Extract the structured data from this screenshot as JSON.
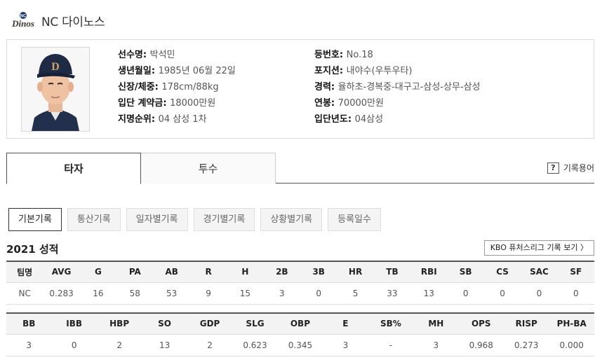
{
  "header": {
    "logo_text": "Dinos",
    "logo_badge": "NC",
    "team_name": "NC 다이노스"
  },
  "player": {
    "left": [
      {
        "key": "선수명: ",
        "value": "박석민"
      },
      {
        "key": "생년월일: ",
        "value": "1985년 06월 22일"
      },
      {
        "key": "신장/체중: ",
        "value": "178cm/88kg"
      },
      {
        "key": "입단 계약금: ",
        "value": "18000만원"
      },
      {
        "key": "지명순위: ",
        "value": "04 삼성 1차"
      }
    ],
    "right": [
      {
        "key": "등번호: ",
        "value": "No.18"
      },
      {
        "key": "포지션: ",
        "value": "내야수(우투우타)"
      },
      {
        "key": "경력: ",
        "value": "율하초-경복중-대구고-삼성-상무-삼성"
      },
      {
        "key": "연봉: ",
        "value": "70000만원"
      },
      {
        "key": "입단년도: ",
        "value": "04삼성"
      }
    ]
  },
  "tabs": {
    "batter": "타자",
    "pitcher": "투수"
  },
  "glossary": {
    "icon_text": "?",
    "label": "기록용어"
  },
  "subtabs": [
    "기본기록",
    "통산기록",
    "일자별기록",
    "경기별기록",
    "상황별기록",
    "등록일수"
  ],
  "season_title": "2021 성적",
  "futures_button": "KBO 퓨처스리그 기록 보기 〉",
  "table1": {
    "headers": [
      "팀명",
      "AVG",
      "G",
      "PA",
      "AB",
      "R",
      "H",
      "2B",
      "3B",
      "HR",
      "TB",
      "RBI",
      "SB",
      "CS",
      "SAC",
      "SF"
    ],
    "row": [
      "NC",
      "0.283",
      "16",
      "58",
      "53",
      "9",
      "15",
      "3",
      "0",
      "5",
      "33",
      "13",
      "0",
      "0",
      "0",
      "0"
    ]
  },
  "table2": {
    "headers": [
      "BB",
      "IBB",
      "HBP",
      "SO",
      "GDP",
      "SLG",
      "OBP",
      "E",
      "SB%",
      "MH",
      "OPS",
      "RISP",
      "PH-BA"
    ],
    "row": [
      "3",
      "0",
      "2",
      "13",
      "2",
      "0.623",
      "0.345",
      "3",
      "-",
      "3",
      "0.968",
      "0.273",
      "0.000"
    ]
  },
  "colors": {
    "logo_navy": "#1c3868",
    "logo_gold": "#b0925a",
    "cap_navy": "#1f2a44"
  }
}
